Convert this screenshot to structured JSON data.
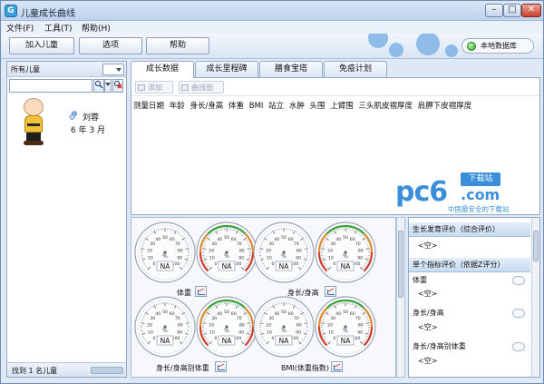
{
  "window": {
    "title": "儿童成长曲线",
    "app_icon_letter": "G",
    "min_glyph": "–",
    "max_glyph": "□",
    "close_glyph": "✕"
  },
  "menu": [
    "文件(F)",
    "工具(T)",
    "帮助(H)"
  ],
  "toolbar": {
    "add_child": "加入儿童",
    "options": "选项",
    "help": "帮助",
    "db_status": "本地数据库",
    "status_color": "#35a829"
  },
  "left": {
    "title": "所有儿童",
    "search_placeholder": "",
    "search_icon": "search-icon",
    "clear_icon": "clear-filter-icon",
    "child": {
      "name": "刘蓉",
      "age": "6 年 3 月",
      "gender_icon": "female-icon"
    },
    "footer": "找到 1 名儿童"
  },
  "tabs": [
    "成长数据",
    "成长里程碑",
    "膳食宝塔",
    "免疫计划"
  ],
  "main": {
    "add_button": "添加",
    "curve_button": "曲线图",
    "columns": [
      "测量日期",
      "年龄",
      "身长/身高",
      "体重",
      "BMI",
      "站立",
      "水肿",
      "头围",
      "上臂围",
      "三头肌皮褶厚度",
      "肩胛下皮褶厚度"
    ]
  },
  "watermark": {
    "logo": "pc6",
    "badge": "下载站",
    "domain": ".com",
    "tagline": "中国最安全的下载站"
  },
  "gauges": {
    "value_text": "NA",
    "unit_text": "%",
    "tick_labels": [
      "0",
      "10",
      "20",
      "30",
      "40",
      "50",
      "60",
      "70",
      "80",
      "90",
      "100"
    ],
    "pairs": [
      {
        "label": "体重"
      },
      {
        "label": "身长/身高"
      },
      {
        "label": "身长/身高别体重"
      },
      {
        "label": "BMI(体重指数)"
      }
    ]
  },
  "evaluation": {
    "growth_title": "生长发育评价（综合评价）",
    "empty": "<空>",
    "single_title": "单个指标评价（依据Z评分）",
    "items": [
      "体重",
      "身长/身高",
      "身长/身高别体重"
    ]
  },
  "colors": {
    "accent": "#3b8fd9",
    "gauge_green": "#3aa33a",
    "gauge_orange": "#e28a2b",
    "gauge_red": "#d53b2b"
  }
}
